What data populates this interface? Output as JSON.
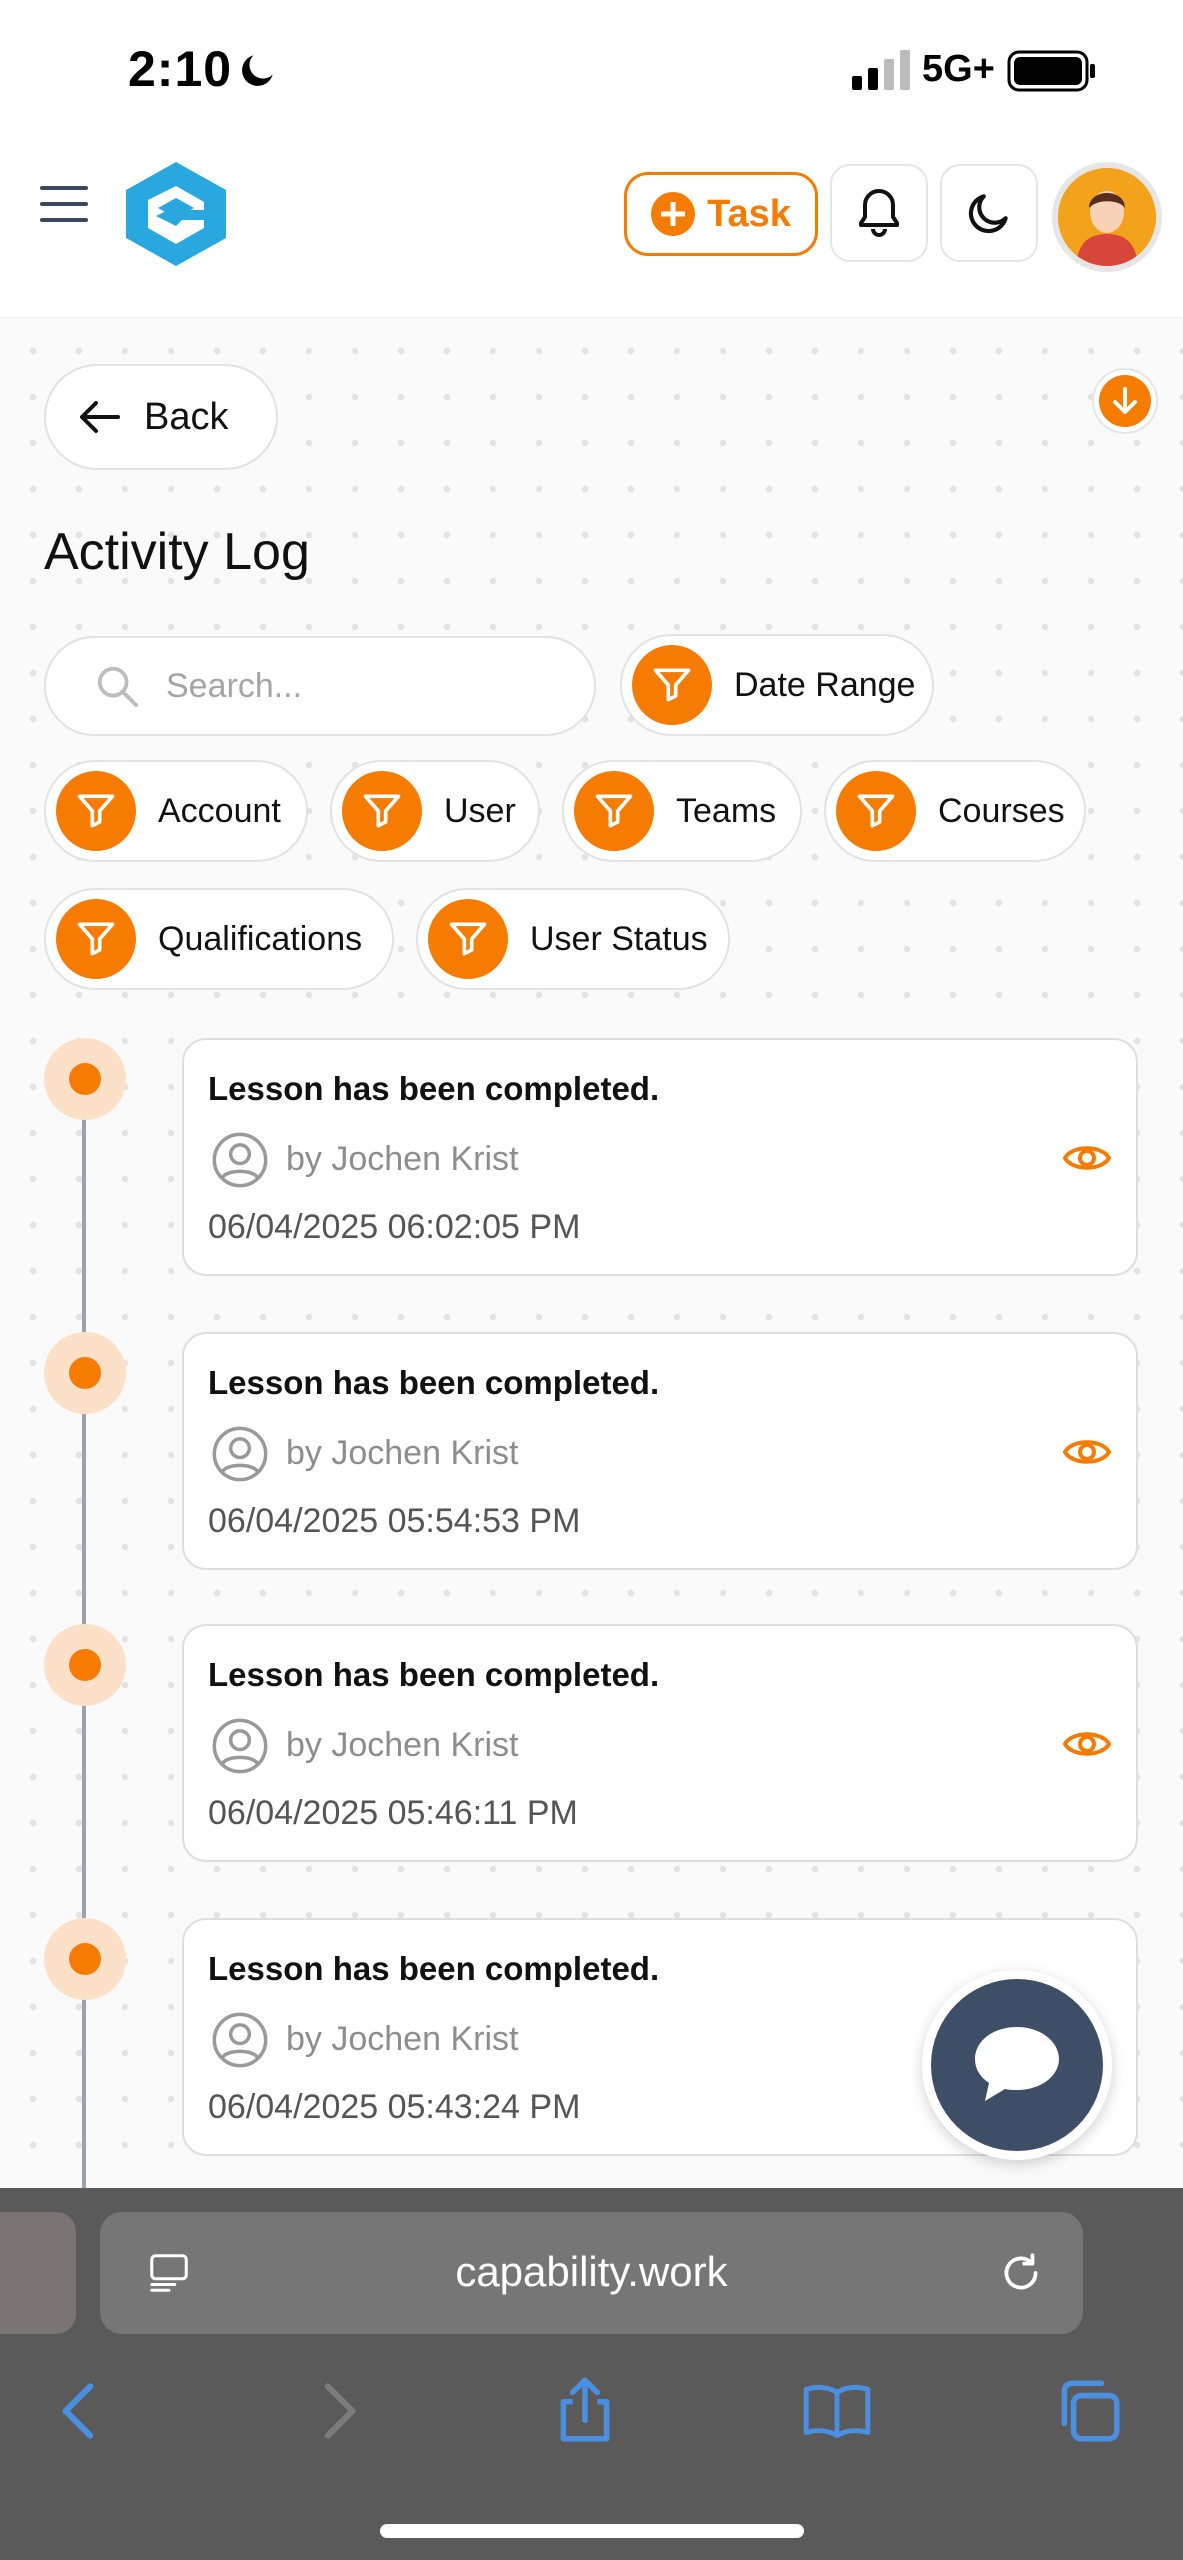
{
  "status_bar": {
    "time": "2:10",
    "network": "5G+"
  },
  "header": {
    "task_label": "Task",
    "icons": [
      "hamburger-menu-icon",
      "logo",
      "bell-icon",
      "moon-icon",
      "avatar"
    ]
  },
  "page": {
    "back_label": "Back",
    "title": "Activity Log"
  },
  "search": {
    "placeholder": "Search..."
  },
  "filters": [
    "Date Range",
    "Account",
    "User",
    "Teams",
    "Courses",
    "Qualifications",
    "User Status"
  ],
  "activities": [
    {
      "title": "Lesson has been completed.",
      "user": "by Jochen Krist",
      "timestamp": "06/04/2025 06:02:05 PM"
    },
    {
      "title": "Lesson has been completed.",
      "user": "by Jochen Krist",
      "timestamp": "06/04/2025 05:54:53 PM"
    },
    {
      "title": "Lesson has been completed.",
      "user": "by Jochen Krist",
      "timestamp": "06/04/2025 05:46:11 PM"
    },
    {
      "title": "Lesson has been completed.",
      "user": "by Jochen Krist",
      "timestamp": "06/04/2025 05:43:24 PM"
    }
  ],
  "browser": {
    "url": "capability.work"
  },
  "colors": {
    "accent": "#f57c00",
    "accent_light": "#fde0c8",
    "chat": "#3e4e66",
    "browser_bar": "#5a5a5a",
    "nav_icon": "#4a8fe0"
  }
}
